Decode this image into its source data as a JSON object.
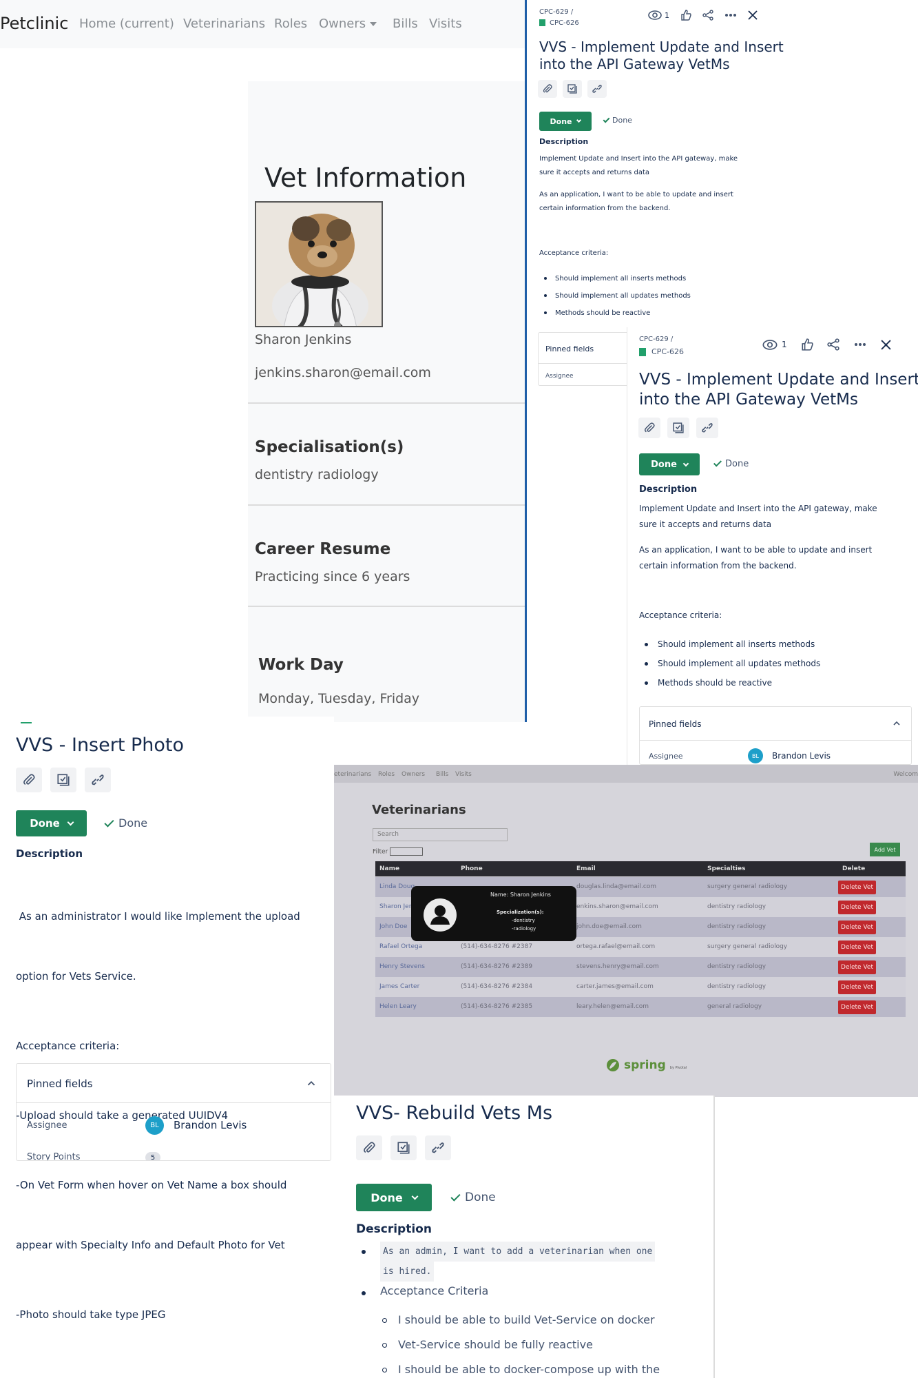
{
  "petclinic": {
    "brand": "Petclinic",
    "nav": [
      "Home (current)",
      "Veterinarians",
      "Roles",
      "Owners",
      "Bills",
      "Visits"
    ],
    "title": "Vet Information",
    "name": "Sharon Jenkins",
    "email": "jenkins.sharon@email.com",
    "spec_heading": "Specialisation(s)",
    "spec_value": "dentistry radiology",
    "career_heading": "Career Resume",
    "career_value": "Practicing since 6 years",
    "workday_heading": "Work Day",
    "workday_value": "Monday, Tuesday, Friday"
  },
  "jira1": {
    "breadcrumb_parent": "CPC-629",
    "breadcrumb_sep": "/",
    "issue_key": "CPC-626",
    "watch_count": "1",
    "title_line1": "VVS - Implement Update and Insert",
    "title_line2": "into the API Gateway VetMs",
    "status": "Done",
    "resolution": "Done",
    "desc_heading": "Description",
    "desc_p1_line1": "Implement Update and Insert into the API gateway, make",
    "desc_p1_line2": "sure it accepts and returns data",
    "desc_p2_line1": "As an application, I want to be able to update and insert",
    "desc_p2_line2": "certain information from the backend.",
    "ac_heading": "Acceptance criteria:",
    "ac_items": [
      "Should implement all inserts methods",
      "Should implement all updates methods",
      "Methods should be reactive"
    ],
    "pinned": "Pinned fields",
    "assignee_label": "Assignee"
  },
  "jira2": {
    "breadcrumb_parent": "CPC-629",
    "breadcrumb_sep": "/",
    "issue_key": "CPC-626",
    "watch_count": "1",
    "title_line1": "VVS - Implement Update and Insert",
    "title_line2": "into the API Gateway VetMs",
    "status": "Done",
    "resolution": "Done",
    "desc_heading": "Description",
    "desc_p1_line1": "Implement Update and Insert into the API gateway, make",
    "desc_p1_line2": "sure it accepts and returns data",
    "desc_p2_line1": "As an application, I want to be able to update and insert",
    "desc_p2_line2": "certain information from the backend.",
    "ac_heading": "Acceptance criteria:",
    "ac_items": [
      "Should implement all inserts methods",
      "Should implement all updates methods",
      "Methods should be reactive"
    ],
    "pinned": "Pinned fields",
    "assignee_label": "Assignee",
    "assignee_initials": "BL",
    "assignee_name": "Brandon Levis"
  },
  "insert_photo": {
    "title": "VVS - Insert Photo",
    "status": "Done",
    "resolution": "Done",
    "desc_heading": "Description",
    "line1": " As an administrator I would like Implement the upload",
    "line2": "option for Vets Service.",
    "line3": "Acceptance criteria:",
    "line4": "-Upload should take a generated UUIDV4",
    "line5": "-On Vet Form when hover on Vet Name a box should",
    "line6": "appear with Specialty Info and Default Photo for Vet",
    "line7": "-Photo should take type JPEG",
    "pinned": "Pinned fields",
    "assignee_label": "Assignee",
    "assignee_initials": "BL",
    "assignee_name": "Brandon Levis",
    "story_points_label": "Story Points",
    "story_points": "5"
  },
  "photo_screen": {
    "nav": [
      "eterinarians",
      "Roles",
      "Owners",
      "Bills",
      "Visits"
    ],
    "welcome": "Welcom",
    "title": "Veterinarians",
    "search_placeholder": "Search",
    "filter_label": "Filter",
    "add_vet": "Add Vet",
    "columns": [
      "Name",
      "Phone",
      "Email",
      "Specialties",
      "Delete"
    ],
    "rows": [
      {
        "name": "Linda Doug",
        "phone": "",
        "email": "douglas.linda@email.com",
        "spec": "surgery general radiology",
        "del": "Delete Vet"
      },
      {
        "name": "Sharon Jen",
        "phone": "",
        "email": "enkins.sharon@email.com",
        "spec": "dentistry radiology",
        "del": "Delete Vet"
      },
      {
        "name": "John Doe",
        "phone": "",
        "email": "john.doe@email.com",
        "spec": "dentistry radiology",
        "del": "Delete Vet"
      },
      {
        "name": "Rafael Ortega",
        "phone": "(514)-634-8276 #2387",
        "email": "ortega.rafael@email.com",
        "spec": "surgery general radiology",
        "del": "Delete Vet"
      },
      {
        "name": "Henry Stevens",
        "phone": "(514)-634-8276 #2389",
        "email": "stevens.henry@email.com",
        "spec": "dentistry radiology",
        "del": "Delete Vet"
      },
      {
        "name": "James Carter",
        "phone": "(514)-634-8276 #2384",
        "email": "carter.james@email.com",
        "spec": "dentistry radiology",
        "del": "Delete Vet"
      },
      {
        "name": "Helen Leary",
        "phone": "(514)-634-8276 #2385",
        "email": "leary.helen@email.com",
        "spec": "general radiology",
        "del": "Delete Vet"
      }
    ],
    "popup_name": "Name: Sharon Jenkins",
    "popup_spec_heading": "Specialization(s):",
    "popup_spec1": "-dentistry",
    "popup_spec2": "-radiology",
    "footer_logo": "spring",
    "footer_sub": "by Pivotal"
  },
  "rebuild": {
    "title": "VVS- Rebuild Vets Ms",
    "status": "Done",
    "resolution": "Done",
    "desc_heading": "Description",
    "code_line1": "As an admin, I want to add a veterinarian when one",
    "code_line2": "is hired.",
    "ac_heading": "Acceptance Criteria",
    "ac_items": [
      "I should be able to build Vet-Service on docker",
      "Vet-Service should be fully reactive",
      "I should be able to docker-compose up with the"
    ]
  },
  "colors": {
    "done_green": "#1f845a",
    "divider_blue": "#1f5fa8",
    "delete_red": "#c0282d",
    "avatar_teal": "#1d9fc9"
  }
}
